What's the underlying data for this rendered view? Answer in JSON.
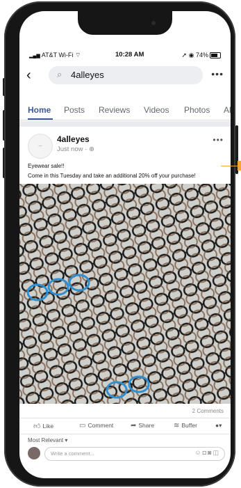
{
  "status": {
    "carrier": "AT&T Wi-Fi",
    "time": "10:28 AM",
    "battery": "74%"
  },
  "search": {
    "query": "4alleyes"
  },
  "tabs": [
    "Home",
    "Posts",
    "Reviews",
    "Videos",
    "Photos",
    "Al"
  ],
  "post": {
    "page_name": "4alleyes",
    "time": "Just now",
    "line1": "Eyewear sale!!",
    "line2": "Come in this Tuesday and take an additional 20% off your purchase!",
    "comments_count": "2 Comments"
  },
  "actions": {
    "like": "Like",
    "comment": "Comment",
    "share": "Share",
    "buffer": "Buffer"
  },
  "comments": {
    "sort": "Most Relevant",
    "placeholder": "Write a comment..."
  },
  "colors": {
    "accent": "#3b5998",
    "callout": "#f2a33a"
  }
}
